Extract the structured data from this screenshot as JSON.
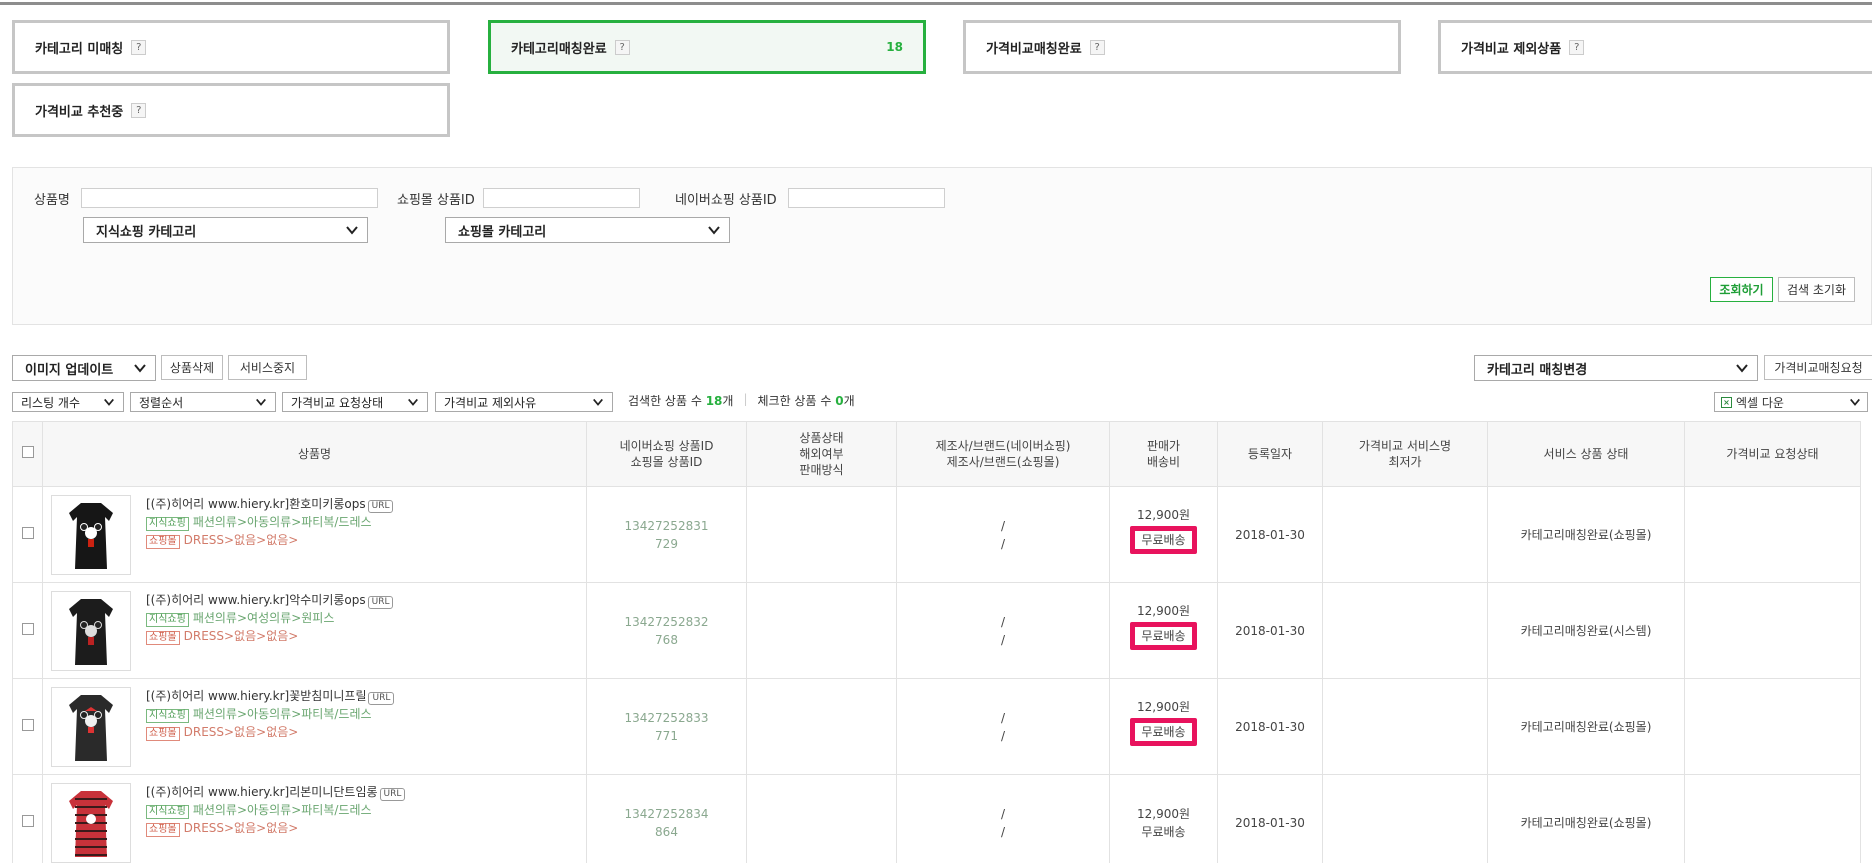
{
  "tabs": [
    {
      "label": "카테고리 미매칭",
      "help": "?",
      "count": ""
    },
    {
      "label": "카테고리매칭완료",
      "help": "?",
      "count": "18"
    },
    {
      "label": "가격비교매칭완료",
      "help": "?",
      "count": ""
    },
    {
      "label": "가격비교 제외상품",
      "help": "?",
      "count": ""
    },
    {
      "label": "가격비교 추천중",
      "help": "?",
      "count": ""
    }
  ],
  "search": {
    "product_name_label": "상품명",
    "mall_id_label": "쇼핑몰 상품ID",
    "naver_id_label": "네이버쇼핑 상품ID",
    "knowledge_category": "지식쇼핑 카테고리",
    "mall_category": "쇼핑몰 카테고리",
    "search_button": "조회하기",
    "reset_button": "검색 초기화"
  },
  "toolbar": {
    "image_update": "이미지 업데이트",
    "delete_button": "상품삭제",
    "stop_button": "서비스중지",
    "category_change": "카테고리 매칭변경",
    "price_compare_request": "가격비교매칭요청",
    "listing_count": "리스팅 개수",
    "sort_order": "정렬순서",
    "request_status": "가격비교 요청상태",
    "exclude_reason": "가격비교 제외사유",
    "searched_label": "검색한 상품 수",
    "searched_count": "18",
    "searched_unit": "개",
    "checked_label": "체크한 상품 수",
    "checked_count": "0",
    "checked_unit": "개",
    "excel_download": "엑셀 다운"
  },
  "table": {
    "headers": {
      "name": "상품명",
      "ids_1": "네이버쇼핑 상품ID",
      "ids_2": "쇼핑몰 상품ID",
      "status_1": "상품상태",
      "status_2": "해외여부",
      "status_3": "판매방식",
      "maker_1": "제조사/브랜드(네이버쇼핑)",
      "maker_2": "제조사/브랜드(쇼핑몰)",
      "price_1": "판매가",
      "price_2": "배송비",
      "date": "등록일자",
      "svc_1": "가격비교 서비스명",
      "svc_2": "최저가",
      "service_status": "서비스 상품 상태",
      "request_status": "가격비교 요청상태"
    },
    "url_badge": "URL",
    "tag_knowledge": "지식쇼핑",
    "tag_mall": "쇼핑몰",
    "rows": [
      {
        "name": "[(주)히어리 www.hiery.kr]환호미키롱ops",
        "knowledge_cat": "패션의류>아동의류>파티복/드레스",
        "mall_cat": "DRESS>없음>없음>",
        "naver_id": "13427252831",
        "mall_id": "729",
        "maker_1": "/",
        "maker_2": "/",
        "price": "12,900원",
        "shipping": "무료배송",
        "date": "2018-01-30",
        "service_status": "카테고리매칭완료(쇼핑몰)"
      },
      {
        "name": "[(주)히어리 www.hiery.kr]악수미키롱ops",
        "knowledge_cat": "패션의류>여성의류>원피스",
        "mall_cat": "DRESS>없음>없음>",
        "naver_id": "13427252832",
        "mall_id": "768",
        "maker_1": "/",
        "maker_2": "/",
        "price": "12,900원",
        "shipping": "무료배송",
        "date": "2018-01-30",
        "service_status": "카테고리매칭완료(시스템)"
      },
      {
        "name": "[(주)히어리 www.hiery.kr]꽃받침미니프릴",
        "knowledge_cat": "패션의류>아동의류>파티복/드레스",
        "mall_cat": "DRESS>없음>없음>",
        "naver_id": "13427252833",
        "mall_id": "771",
        "maker_1": "/",
        "maker_2": "/",
        "price": "12,900원",
        "shipping": "무료배송",
        "date": "2018-01-30",
        "service_status": "카테고리매칭완료(쇼핑몰)"
      },
      {
        "name": "[(주)히어리 www.hiery.kr]리본미니단트임롱",
        "knowledge_cat": "패션의류>아동의류>파티복/드레스",
        "mall_cat": "DRESS>없음>없음>",
        "naver_id": "13427252834",
        "mall_id": "864",
        "maker_1": "/",
        "maker_2": "/",
        "price": "12,900원",
        "shipping": "무료배송",
        "date": "2018-01-30",
        "service_status": "카테고리매칭완료(쇼핑몰)"
      }
    ]
  },
  "colors": {
    "accent_green": "#27b03f",
    "highlight_pink": "#e8135d"
  }
}
